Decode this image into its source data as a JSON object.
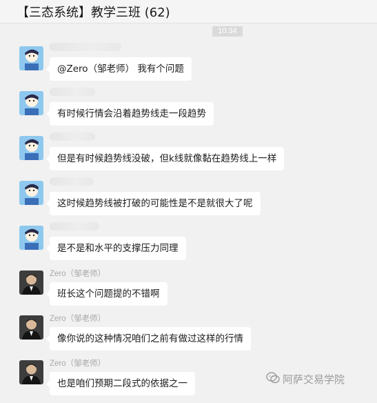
{
  "window": {
    "title": "【三态系统】教学三班 (62)"
  },
  "timestamp": "10:34",
  "messages": [
    {
      "sender": "",
      "text": "@Zero（邹老师） 我有个问题",
      "avatar": "student-cartoon-avatar"
    },
    {
      "sender": "",
      "text": "有时候行情会沿着趋势线走一段趋势",
      "avatar": "student-cartoon-avatar"
    },
    {
      "sender": "",
      "text": "但是有时候趋势线没破，但k线就像黏在趋势线上一样",
      "avatar": "student-cartoon-avatar"
    },
    {
      "sender": "",
      "text": "这时候趋势线被打破的可能性是不是就很大了呢",
      "avatar": "student-cartoon-avatar"
    },
    {
      "sender": "",
      "text": "是不是和水平的支撑压力同理",
      "avatar": "student-cartoon-avatar"
    },
    {
      "sender": "Zero（邹老师）",
      "text": "班长这个问题提的不错啊",
      "avatar": "teacher-photo-avatar"
    },
    {
      "sender": "Zero（邹老师）",
      "text": "像你说的这种情况咱们之前有做过这样的行情",
      "avatar": "teacher-photo-avatar"
    },
    {
      "sender": "Zero（邹老师）",
      "text": "也是咱们预期二段式的依据之一",
      "avatar": "teacher-photo-avatar"
    }
  ],
  "watermark": {
    "text": "阿萨交易学院",
    "icon": "wechat-logo-icon"
  }
}
